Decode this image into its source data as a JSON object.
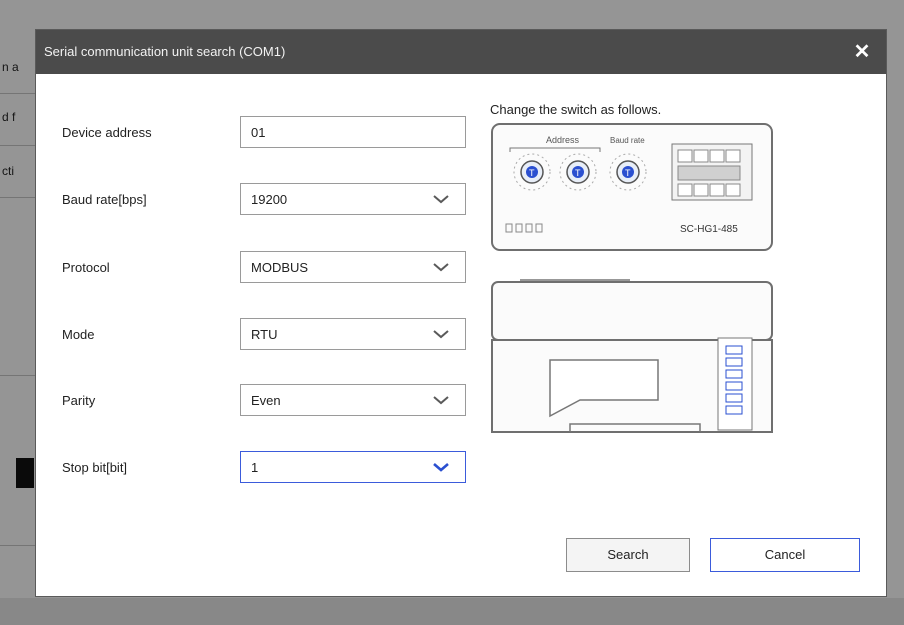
{
  "background": {
    "fragments": [
      "n a",
      "d f",
      "cti"
    ]
  },
  "dialog": {
    "title": "Serial communication unit search (COM1)",
    "close_glyph": "✕",
    "fields": [
      {
        "label": "Device address",
        "value": "01",
        "kind": "text"
      },
      {
        "label": "Baud rate[bps]",
        "value": "19200",
        "kind": "select"
      },
      {
        "label": "Protocol",
        "value": "MODBUS",
        "kind": "select"
      },
      {
        "label": "Mode",
        "value": "RTU",
        "kind": "select"
      },
      {
        "label": "Parity",
        "value": "Even",
        "kind": "select"
      },
      {
        "label": "Stop bit[bit]",
        "value": "1",
        "kind": "select"
      }
    ],
    "instruction": "Change the switch as follows.",
    "diagram": {
      "address_label": "Address",
      "baud_label": "Baud rate",
      "model": "SC-HG1-485"
    },
    "buttons": {
      "search": "Search",
      "cancel": "Cancel"
    }
  },
  "colors": {
    "titlebar": "#4b4b4b",
    "focus": "#3b5bdb",
    "accent_chevron": "#2a4fd0"
  }
}
